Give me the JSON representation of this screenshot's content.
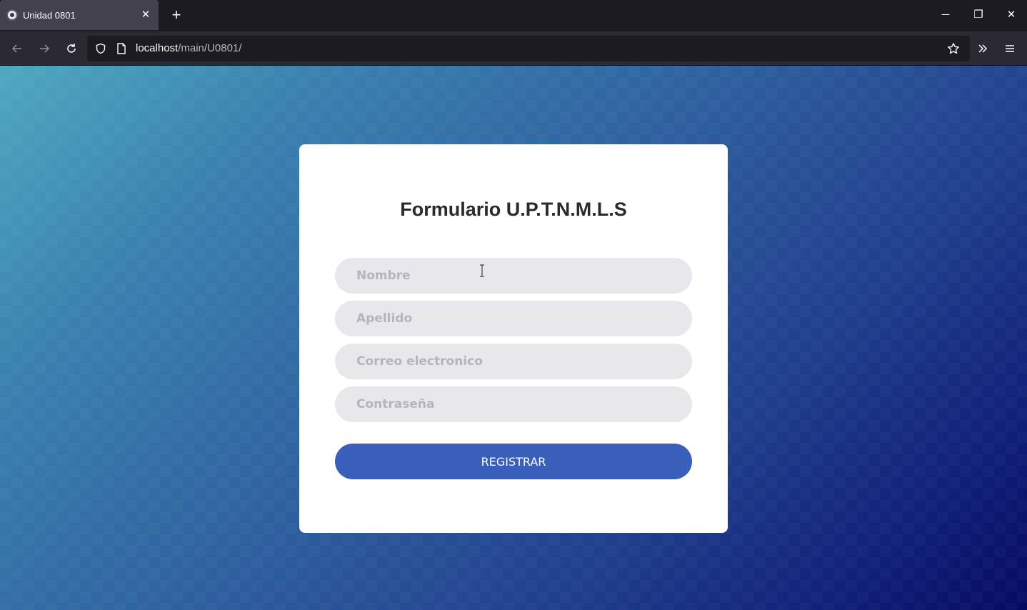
{
  "browser": {
    "tab_title": "Unidad 0801",
    "tab_close": "✕",
    "new_tab": "+",
    "url_host": "localhost",
    "url_path": "/main/U0801/"
  },
  "window_controls": {
    "minimize": "─",
    "restore": "❐",
    "close": "✕"
  },
  "form": {
    "title": "Formulario U.P.T.N.M.L.S",
    "fields": {
      "nombre_placeholder": "Nombre",
      "apellido_placeholder": "Apellido",
      "correo_placeholder": "Correo electronico",
      "password_placeholder": "Contraseña"
    },
    "submit_label": "REGISTRAR"
  },
  "colors": {
    "button": "#3a5fba",
    "card": "#ffffff",
    "input_bg": "#e8e8ec"
  }
}
